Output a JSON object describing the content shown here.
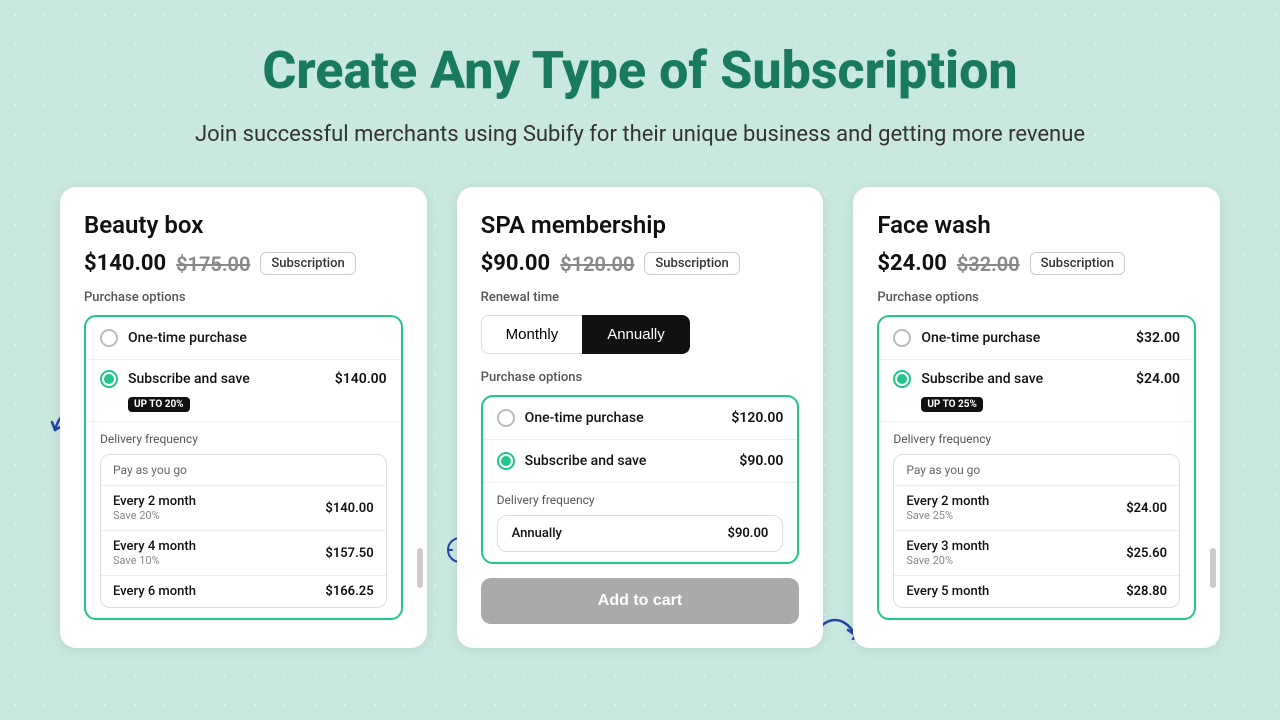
{
  "header": {
    "title": "Create Any Type of Subscription",
    "subtitle": "Join successful merchants using Subify for their unique business and getting more revenue"
  },
  "cards": [
    {
      "id": "beauty-box",
      "title": "Beauty box",
      "price_current": "$140.00",
      "price_original": "$175.00",
      "badge": "Subscription",
      "section_label": "Purchase options",
      "options": [
        {
          "label": "One-time purchase",
          "price": "",
          "selected": false
        },
        {
          "label": "Subscribe and save",
          "price": "$140.00",
          "selected": true,
          "discount_badge": "UP To 20%"
        }
      ],
      "delivery_label": "Delivery frequency",
      "freq_header": "Pay as you go",
      "frequencies": [
        {
          "name": "Every 2 month",
          "save": "Save 20%",
          "price": "$140.00"
        },
        {
          "name": "Every 4 month",
          "save": "Save 10%",
          "price": "$157.50"
        },
        {
          "name": "Every 6 month",
          "save": "",
          "price": "$166.25"
        }
      ]
    },
    {
      "id": "spa-membership",
      "title": "SPA membership",
      "price_current": "$90.00",
      "price_original": "$120.00",
      "badge": "Subscription",
      "renewal_label": "Renewal time",
      "toggle_monthly": "Monthly",
      "toggle_annually": "Annually",
      "active_toggle": "annually",
      "section_label": "Purchase options",
      "options": [
        {
          "label": "One-time purchase",
          "price": "$120.00",
          "selected": false
        },
        {
          "label": "Subscribe and save",
          "price": "$90.00",
          "selected": true
        }
      ],
      "delivery_label": "Delivery frequency",
      "annually_label": "Annually",
      "annually_price": "$90.00",
      "add_to_cart": "Add to cart"
    },
    {
      "id": "face-wash",
      "title": "Face wash",
      "price_current": "$24.00",
      "price_original": "$32.00",
      "badge": "Subscription",
      "section_label": "Purchase options",
      "options": [
        {
          "label": "One-time purchase",
          "price": "$32.00",
          "selected": false
        },
        {
          "label": "Subscribe and save",
          "price": "$24.00",
          "selected": true,
          "discount_badge": "UP To 25%"
        }
      ],
      "delivery_label": "Delivery frequency",
      "freq_header": "Pay as you go",
      "frequencies": [
        {
          "name": "Every 2 month",
          "save": "Save 25%",
          "price": "$24.00"
        },
        {
          "name": "Every 3 month",
          "save": "Save 20%",
          "price": "$25.60"
        },
        {
          "name": "Every 5 month",
          "save": "",
          "price": "$28.80"
        }
      ]
    }
  ]
}
